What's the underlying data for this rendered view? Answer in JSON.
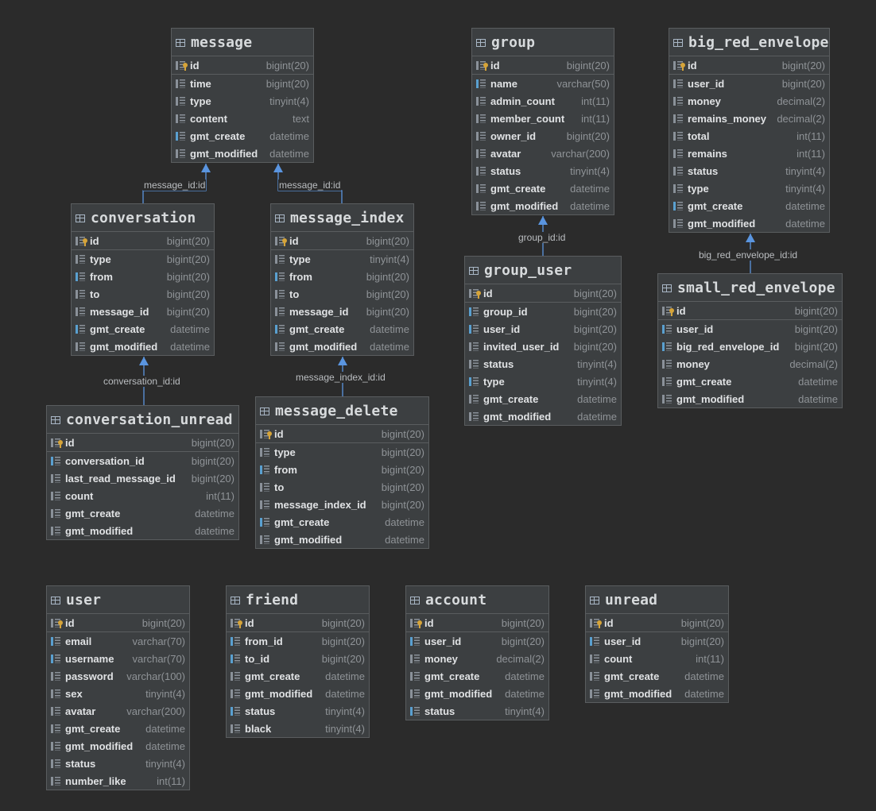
{
  "tables": [
    {
      "name": "message",
      "columns": [
        {
          "name": "id",
          "type": "bigint(20)",
          "key": "pk"
        },
        {
          "name": "time",
          "type": "bigint(20)",
          "key": ""
        },
        {
          "name": "type",
          "type": "tinyint(4)",
          "key": ""
        },
        {
          "name": "content",
          "type": "text",
          "key": ""
        },
        {
          "name": "gmt_create",
          "type": "datetime",
          "key": "fk"
        },
        {
          "name": "gmt_modified",
          "type": "datetime",
          "key": ""
        }
      ]
    },
    {
      "name": "group",
      "columns": [
        {
          "name": "id",
          "type": "bigint(20)",
          "key": "pk"
        },
        {
          "name": "name",
          "type": "varchar(50)",
          "key": "fk"
        },
        {
          "name": "admin_count",
          "type": "int(11)",
          "key": ""
        },
        {
          "name": "member_count",
          "type": "int(11)",
          "key": ""
        },
        {
          "name": "owner_id",
          "type": "bigint(20)",
          "key": ""
        },
        {
          "name": "avatar",
          "type": "varchar(200)",
          "key": ""
        },
        {
          "name": "status",
          "type": "tinyint(4)",
          "key": ""
        },
        {
          "name": "gmt_create",
          "type": "datetime",
          "key": ""
        },
        {
          "name": "gmt_modified",
          "type": "datetime",
          "key": ""
        }
      ]
    },
    {
      "name": "big_red_envelope",
      "columns": [
        {
          "name": "id",
          "type": "bigint(20)",
          "key": "pk"
        },
        {
          "name": "user_id",
          "type": "bigint(20)",
          "key": ""
        },
        {
          "name": "money",
          "type": "decimal(2)",
          "key": ""
        },
        {
          "name": "remains_money",
          "type": "decimal(2)",
          "key": ""
        },
        {
          "name": "total",
          "type": "int(11)",
          "key": ""
        },
        {
          "name": "remains",
          "type": "int(11)",
          "key": ""
        },
        {
          "name": "status",
          "type": "tinyint(4)",
          "key": ""
        },
        {
          "name": "type",
          "type": "tinyint(4)",
          "key": ""
        },
        {
          "name": "gmt_create",
          "type": "datetime",
          "key": "fk"
        },
        {
          "name": "gmt_modified",
          "type": "datetime",
          "key": ""
        }
      ]
    },
    {
      "name": "conversation",
      "columns": [
        {
          "name": "id",
          "type": "bigint(20)",
          "key": "pk"
        },
        {
          "name": "type",
          "type": "bigint(20)",
          "key": ""
        },
        {
          "name": "from",
          "type": "bigint(20)",
          "key": "fk"
        },
        {
          "name": "to",
          "type": "bigint(20)",
          "key": ""
        },
        {
          "name": "message_id",
          "type": "bigint(20)",
          "key": ""
        },
        {
          "name": "gmt_create",
          "type": "datetime",
          "key": "fk"
        },
        {
          "name": "gmt_modified",
          "type": "datetime",
          "key": ""
        }
      ]
    },
    {
      "name": "message_index",
      "columns": [
        {
          "name": "id",
          "type": "bigint(20)",
          "key": "pk"
        },
        {
          "name": "type",
          "type": "tinyint(4)",
          "key": ""
        },
        {
          "name": "from",
          "type": "bigint(20)",
          "key": "fk"
        },
        {
          "name": "to",
          "type": "bigint(20)",
          "key": ""
        },
        {
          "name": "message_id",
          "type": "bigint(20)",
          "key": ""
        },
        {
          "name": "gmt_create",
          "type": "datetime",
          "key": "fk"
        },
        {
          "name": "gmt_modified",
          "type": "datetime",
          "key": ""
        }
      ]
    },
    {
      "name": "group_user",
      "columns": [
        {
          "name": "id",
          "type": "bigint(20)",
          "key": "pk"
        },
        {
          "name": "group_id",
          "type": "bigint(20)",
          "key": "fk"
        },
        {
          "name": "user_id",
          "type": "bigint(20)",
          "key": "fk"
        },
        {
          "name": "invited_user_id",
          "type": "bigint(20)",
          "key": ""
        },
        {
          "name": "status",
          "type": "tinyint(4)",
          "key": ""
        },
        {
          "name": "type",
          "type": "tinyint(4)",
          "key": "fk"
        },
        {
          "name": "gmt_create",
          "type": "datetime",
          "key": ""
        },
        {
          "name": "gmt_modified",
          "type": "datetime",
          "key": ""
        }
      ]
    },
    {
      "name": "small_red_envelope",
      "columns": [
        {
          "name": "id",
          "type": "bigint(20)",
          "key": "pk"
        },
        {
          "name": "user_id",
          "type": "bigint(20)",
          "key": "fk"
        },
        {
          "name": "big_red_envelope_id",
          "type": "bigint(20)",
          "key": "fk"
        },
        {
          "name": "money",
          "type": "decimal(2)",
          "key": ""
        },
        {
          "name": "gmt_create",
          "type": "datetime",
          "key": ""
        },
        {
          "name": "gmt_modified",
          "type": "datetime",
          "key": ""
        }
      ]
    },
    {
      "name": "conversation_unread",
      "columns": [
        {
          "name": "id",
          "type": "bigint(20)",
          "key": "pk"
        },
        {
          "name": "conversation_id",
          "type": "bigint(20)",
          "key": "fk"
        },
        {
          "name": "last_read_message_id",
          "type": "bigint(20)",
          "key": ""
        },
        {
          "name": "count",
          "type": "int(11)",
          "key": ""
        },
        {
          "name": "gmt_create",
          "type": "datetime",
          "key": ""
        },
        {
          "name": "gmt_modified",
          "type": "datetime",
          "key": ""
        }
      ]
    },
    {
      "name": "message_delete",
      "columns": [
        {
          "name": "id",
          "type": "bigint(20)",
          "key": "pk"
        },
        {
          "name": "type",
          "type": "bigint(20)",
          "key": ""
        },
        {
          "name": "from",
          "type": "bigint(20)",
          "key": "fk"
        },
        {
          "name": "to",
          "type": "bigint(20)",
          "key": ""
        },
        {
          "name": "message_index_id",
          "type": "bigint(20)",
          "key": ""
        },
        {
          "name": "gmt_create",
          "type": "datetime",
          "key": "fk"
        },
        {
          "name": "gmt_modified",
          "type": "datetime",
          "key": ""
        }
      ]
    },
    {
      "name": "user",
      "columns": [
        {
          "name": "id",
          "type": "bigint(20)",
          "key": "pk"
        },
        {
          "name": "email",
          "type": "varchar(70)",
          "key": "fk"
        },
        {
          "name": "username",
          "type": "varchar(70)",
          "key": "fk"
        },
        {
          "name": "password",
          "type": "varchar(100)",
          "key": ""
        },
        {
          "name": "sex",
          "type": "tinyint(4)",
          "key": ""
        },
        {
          "name": "avatar",
          "type": "varchar(200)",
          "key": ""
        },
        {
          "name": "gmt_create",
          "type": "datetime",
          "key": ""
        },
        {
          "name": "gmt_modified",
          "type": "datetime",
          "key": ""
        },
        {
          "name": "status",
          "type": "tinyint(4)",
          "key": ""
        },
        {
          "name": "number_like",
          "type": "int(11)",
          "key": ""
        }
      ]
    },
    {
      "name": "friend",
      "columns": [
        {
          "name": "id",
          "type": "bigint(20)",
          "key": "pk"
        },
        {
          "name": "from_id",
          "type": "bigint(20)",
          "key": "fk"
        },
        {
          "name": "to_id",
          "type": "bigint(20)",
          "key": "fk"
        },
        {
          "name": "gmt_create",
          "type": "datetime",
          "key": ""
        },
        {
          "name": "gmt_modified",
          "type": "datetime",
          "key": ""
        },
        {
          "name": "status",
          "type": "tinyint(4)",
          "key": "fk"
        },
        {
          "name": "black",
          "type": "tinyint(4)",
          "key": ""
        }
      ]
    },
    {
      "name": "account",
      "columns": [
        {
          "name": "id",
          "type": "bigint(20)",
          "key": "pk"
        },
        {
          "name": "user_id",
          "type": "bigint(20)",
          "key": "fk"
        },
        {
          "name": "money",
          "type": "decimal(2)",
          "key": ""
        },
        {
          "name": "gmt_create",
          "type": "datetime",
          "key": ""
        },
        {
          "name": "gmt_modified",
          "type": "datetime",
          "key": ""
        },
        {
          "name": "status",
          "type": "tinyint(4)",
          "key": "fk"
        }
      ]
    },
    {
      "name": "unread",
      "columns": [
        {
          "name": "id",
          "type": "bigint(20)",
          "key": "pk"
        },
        {
          "name": "user_id",
          "type": "bigint(20)",
          "key": "fk"
        },
        {
          "name": "count",
          "type": "int(11)",
          "key": ""
        },
        {
          "name": "gmt_create",
          "type": "datetime",
          "key": ""
        },
        {
          "name": "gmt_modified",
          "type": "datetime",
          "key": ""
        }
      ]
    }
  ],
  "relations": [
    {
      "label": "message_id:id",
      "from": "conversation",
      "to": "message"
    },
    {
      "label": "message_id:id",
      "from": "message_index",
      "to": "message"
    },
    {
      "label": "group_id:id",
      "from": "group_user",
      "to": "group"
    },
    {
      "label": "big_red_envelope_id:id",
      "from": "small_red_envelope",
      "to": "big_red_envelope"
    },
    {
      "label": "conversation_id:id",
      "from": "conversation_unread",
      "to": "conversation"
    },
    {
      "label": "message_index_id:id",
      "from": "message_delete",
      "to": "message_index"
    }
  ],
  "colors": {
    "background": "#2b2b2b",
    "table": "#3c3f41",
    "edge": "#5a95e0",
    "pk_key": "#d6a439",
    "fk_marker": "#5aa0d0"
  }
}
